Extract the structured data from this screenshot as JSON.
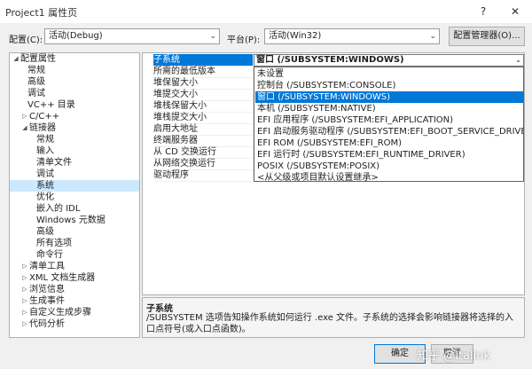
{
  "window": {
    "title": "Project1 属性页",
    "help": "?",
    "close": "✕"
  },
  "toolbar": {
    "config_label": "配置(C):",
    "config_value": "活动(Debug)",
    "platform_label": "平台(P):",
    "platform_value": "活动(Win32)",
    "config_manager": "配置管理器(O)..."
  },
  "tree": {
    "items": [
      {
        "label": "配置属性",
        "expander": "◢"
      },
      {
        "label": "常规"
      },
      {
        "label": "高级"
      },
      {
        "label": "调试"
      },
      {
        "label": "VC++ 目录"
      },
      {
        "label": "C/C++",
        "expander": "▷"
      },
      {
        "label": "链接器",
        "expander": "◢"
      },
      {
        "label": "常规"
      },
      {
        "label": "输入"
      },
      {
        "label": "清单文件"
      },
      {
        "label": "调试"
      },
      {
        "label": "系统"
      },
      {
        "label": "优化"
      },
      {
        "label": "嵌入的 IDL"
      },
      {
        "label": "Windows 元数据"
      },
      {
        "label": "高级"
      },
      {
        "label": "所有选项"
      },
      {
        "label": "命令行"
      },
      {
        "label": "清单工具",
        "expander": "▷"
      },
      {
        "label": "XML 文档生成器",
        "expander": "▷"
      },
      {
        "label": "浏览信息",
        "expander": "▷"
      },
      {
        "label": "生成事件",
        "expander": "▷"
      },
      {
        "label": "自定义生成步骤",
        "expander": "▷"
      },
      {
        "label": "代码分析",
        "expander": "▷"
      }
    ]
  },
  "grid": {
    "rows": [
      "子系统",
      "所需的最低版本",
      "堆保留大小",
      "堆提交大小",
      "堆栈保留大小",
      "堆栈提交大小",
      "启用大地址",
      "终端服务器",
      "从 CD 交换运行",
      "从网络交换运行",
      "驱动程序"
    ],
    "value": "窗口 (/SUBSYSTEM:WINDOWS)",
    "options": [
      "未设置",
      "控制台 (/SUBSYSTEM:CONSOLE)",
      "窗口 (/SUBSYSTEM:WINDOWS)",
      "本机 (/SUBSYSTEM:NATIVE)",
      "EFI 应用程序 (/SUBSYSTEM:EFI_APPLICATION)",
      "EFI 启动服务驱动程序 (/SUBSYSTEM:EFI_BOOT_SERVICE_DRIVER)",
      "EFI ROM (/SUBSYSTEM:EFI_ROM)",
      "EFI 运行时 (/SUBSYSTEM:EFI_RUNTIME_DRIVER)",
      "POSIX (/SUBSYSTEM:POSIX)",
      "<从父级或项目默认设置继承>"
    ]
  },
  "description": {
    "title": "子系统",
    "text": "/SUBSYSTEM 选项告知操作系统如何运行 .exe 文件。子系统的选择会影响链接器将选择的入口点符号(或入口点函数)。"
  },
  "buttons": {
    "ok": "确定",
    "cancel": "取消"
  },
  "watermark": "知乎 @Italink"
}
